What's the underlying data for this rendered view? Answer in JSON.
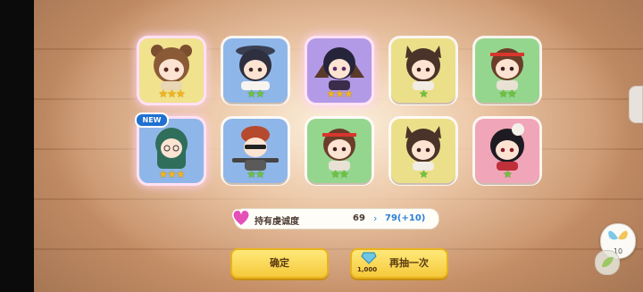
{
  "gacha_results": {
    "cards": [
      {
        "character": "bear-ear girl",
        "rarity": 3,
        "star_color": "gold",
        "bg": "#f1e28e",
        "glow": true,
        "new": false
      },
      {
        "character": "witch hat girl",
        "rarity": 2,
        "star_color": "green",
        "bg": "#8fb6e8",
        "glow": false,
        "new": false
      },
      {
        "character": "bat-wing girl",
        "rarity": 3,
        "star_color": "gold",
        "bg": "#b39ae6",
        "glow": true,
        "new": false
      },
      {
        "character": "wolf-ear girl",
        "rarity": 1,
        "star_color": "green",
        "bg": "#ecdf8a",
        "glow": false,
        "new": false
      },
      {
        "character": "headband girl",
        "rarity": 2,
        "star_color": "green",
        "bg": "#95d68e",
        "glow": false,
        "new": false
      },
      {
        "character": "glasses elf girl",
        "rarity": 3,
        "star_color": "gold",
        "bg": "#8fb6e8",
        "glow": true,
        "new": true
      },
      {
        "character": "sunglasses gunner",
        "rarity": 2,
        "star_color": "green",
        "bg": "#8fb6e8",
        "glow": false,
        "new": false
      },
      {
        "character": "headband girl",
        "rarity": 2,
        "star_color": "green",
        "bg": "#95d68e",
        "glow": false,
        "new": false
      },
      {
        "character": "wolf-ear girl",
        "rarity": 1,
        "star_color": "green",
        "bg": "#ecdf8a",
        "glow": false,
        "new": false
      },
      {
        "character": "skull hat girl",
        "rarity": 1,
        "star_color": "green",
        "bg": "#f0a6b8",
        "glow": false,
        "new": false
      }
    ],
    "new_badge": "NEW"
  },
  "affection": {
    "label": "持有虔诚度",
    "old_value": "69",
    "arrow": "›",
    "new_value": "79(+10)"
  },
  "buttons": {
    "confirm_label": "确定",
    "draw_again_label": "再抽一次",
    "draw_cost": "1,000"
  },
  "side": {
    "item_count": "10"
  },
  "colors": {
    "accent_yellow": "#f5c93b",
    "value_blue": "#2b7fd8",
    "star_gold": "#f2b51e",
    "star_green": "#6ec23c"
  }
}
